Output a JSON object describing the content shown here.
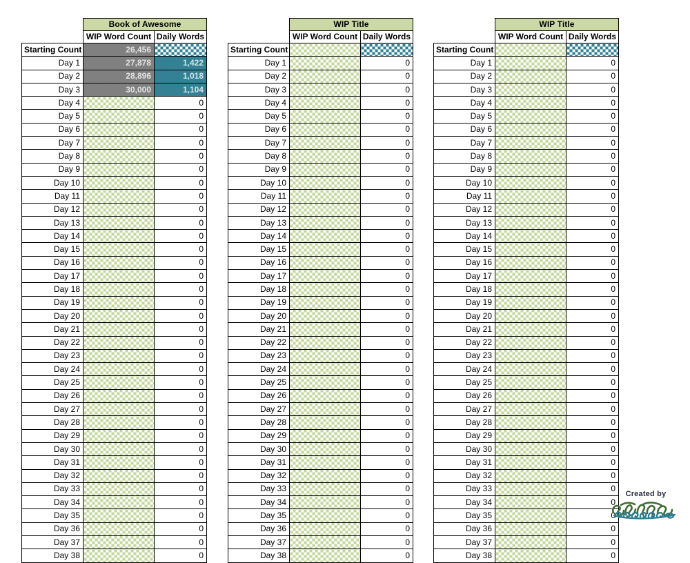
{
  "workbook": {
    "row_labels": [
      "Starting Count",
      "Day 1",
      "Day 2",
      "Day 3",
      "Day 4",
      "Day 5",
      "Day 6",
      "Day 7",
      "Day 8",
      "Day 9",
      "Day 10",
      "Day 11",
      "Day 12",
      "Day 13",
      "Day 14",
      "Day 15",
      "Day 16",
      "Day 17",
      "Day 18",
      "Day 19",
      "Day 20",
      "Day 21",
      "Day 22",
      "Day 23",
      "Day 24",
      "Day 25",
      "Day 26",
      "Day 27",
      "Day 28",
      "Day 29",
      "Day 30",
      "Day 31",
      "Day 32",
      "Day 33",
      "Day 34",
      "Day 35",
      "Day 36",
      "Day 37",
      "Day 38"
    ],
    "column_headers": {
      "wip_word_count": "WIP Word Count",
      "daily_words": "Daily Words"
    },
    "colors": {
      "title_header_green": "#ccd9a6",
      "filled_gray": "#7c7c7c",
      "filled_teal": "#2e7d91",
      "empty_check_green": "#c3d69b",
      "border": "#000000"
    },
    "tables": [
      {
        "id": "table-1",
        "title": "Book of Awesome",
        "wip_word_count": [
          "26,456",
          "27,878",
          "28,896",
          "30,000",
          "",
          "",
          "",
          "",
          "",
          "",
          "",
          "",
          "",
          "",
          "",
          "",
          "",
          "",
          "",
          "",
          "",
          "",
          "",
          "",
          "",
          "",
          "",
          "",
          "",
          "",
          "",
          "",
          "",
          "",
          "",
          "",
          "",
          "",
          ""
        ],
        "wip_word_count_fill": [
          "gray",
          "gray",
          "gray",
          "gray",
          "green-check",
          "green-check",
          "green-check",
          "green-check",
          "green-check",
          "green-check",
          "green-check",
          "green-check",
          "green-check",
          "green-check",
          "green-check",
          "green-check",
          "green-check",
          "green-check",
          "green-check",
          "green-check",
          "green-check",
          "green-check",
          "green-check",
          "green-check",
          "green-check",
          "green-check",
          "green-check",
          "green-check",
          "green-check",
          "green-check",
          "green-check",
          "green-check",
          "green-check",
          "green-check",
          "green-check",
          "green-check",
          "green-check",
          "green-check",
          "green-check"
        ],
        "daily_words": [
          "",
          "1,422",
          "1,018",
          "1,104",
          "0",
          "0",
          "0",
          "0",
          "0",
          "0",
          "0",
          "0",
          "0",
          "0",
          "0",
          "0",
          "0",
          "0",
          "0",
          "0",
          "0",
          "0",
          "0",
          "0",
          "0",
          "0",
          "0",
          "0",
          "0",
          "0",
          "0",
          "0",
          "0",
          "0",
          "0",
          "0",
          "0",
          "0",
          "0"
        ],
        "daily_words_fill": [
          "teal-check",
          "teal",
          "teal",
          "teal",
          "plain",
          "plain",
          "plain",
          "plain",
          "plain",
          "plain",
          "plain",
          "plain",
          "plain",
          "plain",
          "plain",
          "plain",
          "plain",
          "plain",
          "plain",
          "plain",
          "plain",
          "plain",
          "plain",
          "plain",
          "plain",
          "plain",
          "plain",
          "plain",
          "plain",
          "plain",
          "plain",
          "plain",
          "plain",
          "plain",
          "plain",
          "plain",
          "plain",
          "plain",
          "plain"
        ]
      },
      {
        "id": "table-2",
        "title": "WIP Title",
        "wip_word_count": [
          "",
          "",
          "",
          "",
          "",
          "",
          "",
          "",
          "",
          "",
          "",
          "",
          "",
          "",
          "",
          "",
          "",
          "",
          "",
          "",
          "",
          "",
          "",
          "",
          "",
          "",
          "",
          "",
          "",
          "",
          "",
          "",
          "",
          "",
          "",
          "",
          "",
          "",
          ""
        ],
        "wip_word_count_fill": [
          "green-check",
          "green-check",
          "green-check",
          "green-check",
          "green-check",
          "green-check",
          "green-check",
          "green-check",
          "green-check",
          "green-check",
          "green-check",
          "green-check",
          "green-check",
          "green-check",
          "green-check",
          "green-check",
          "green-check",
          "green-check",
          "green-check",
          "green-check",
          "green-check",
          "green-check",
          "green-check",
          "green-check",
          "green-check",
          "green-check",
          "green-check",
          "green-check",
          "green-check",
          "green-check",
          "green-check",
          "green-check",
          "green-check",
          "green-check",
          "green-check",
          "green-check",
          "green-check",
          "green-check",
          "green-check"
        ],
        "daily_words": [
          "",
          "0",
          "0",
          "0",
          "0",
          "0",
          "0",
          "0",
          "0",
          "0",
          "0",
          "0",
          "0",
          "0",
          "0",
          "0",
          "0",
          "0",
          "0",
          "0",
          "0",
          "0",
          "0",
          "0",
          "0",
          "0",
          "0",
          "0",
          "0",
          "0",
          "0",
          "0",
          "0",
          "0",
          "0",
          "0",
          "0",
          "0",
          "0"
        ],
        "daily_words_fill": [
          "teal-check",
          "plain",
          "plain",
          "plain",
          "plain",
          "plain",
          "plain",
          "plain",
          "plain",
          "plain",
          "plain",
          "plain",
          "plain",
          "plain",
          "plain",
          "plain",
          "plain",
          "plain",
          "plain",
          "plain",
          "plain",
          "plain",
          "plain",
          "plain",
          "plain",
          "plain",
          "plain",
          "plain",
          "plain",
          "plain",
          "plain",
          "plain",
          "plain",
          "plain",
          "plain",
          "plain",
          "plain",
          "plain",
          "plain"
        ]
      },
      {
        "id": "table-3",
        "title": "WIP Title",
        "wip_word_count": [
          "",
          "",
          "",
          "",
          "",
          "",
          "",
          "",
          "",
          "",
          "",
          "",
          "",
          "",
          "",
          "",
          "",
          "",
          "",
          "",
          "",
          "",
          "",
          "",
          "",
          "",
          "",
          "",
          "",
          "",
          "",
          "",
          "",
          "",
          "",
          "",
          "",
          "",
          ""
        ],
        "wip_word_count_fill": [
          "green-check",
          "green-check",
          "green-check",
          "green-check",
          "green-check",
          "green-check",
          "green-check",
          "green-check",
          "green-check",
          "green-check",
          "green-check",
          "green-check",
          "green-check",
          "green-check",
          "green-check",
          "green-check",
          "green-check",
          "green-check",
          "green-check",
          "green-check",
          "green-check",
          "green-check",
          "green-check",
          "green-check",
          "green-check",
          "green-check",
          "green-check",
          "green-check",
          "green-check",
          "green-check",
          "green-check",
          "green-check",
          "green-check",
          "green-check",
          "green-check",
          "green-check",
          "green-check",
          "green-check",
          "green-check"
        ],
        "daily_words": [
          "",
          "0",
          "0",
          "0",
          "0",
          "0",
          "0",
          "0",
          "0",
          "0",
          "0",
          "0",
          "0",
          "0",
          "0",
          "0",
          "0",
          "0",
          "0",
          "0",
          "0",
          "0",
          "0",
          "0",
          "0",
          "0",
          "0",
          "0",
          "0",
          "0",
          "0",
          "0",
          "0",
          "0",
          "0",
          "0",
          "0",
          "0",
          "0"
        ],
        "daily_words_fill": [
          "teal-check",
          "plain",
          "plain",
          "plain",
          "plain",
          "plain",
          "plain",
          "plain",
          "plain",
          "plain",
          "plain",
          "plain",
          "plain",
          "plain",
          "plain",
          "plain",
          "plain",
          "plain",
          "plain",
          "plain",
          "plain",
          "plain",
          "plain",
          "plain",
          "plain",
          "plain",
          "plain",
          "plain",
          "plain",
          "plain",
          "plain",
          "plain",
          "plain",
          "plain",
          "plain",
          "plain",
          "plain",
          "plain",
          "plain"
        ]
      }
    ]
  },
  "credit": {
    "label": "Created by",
    "logo_text": "svenja"
  }
}
